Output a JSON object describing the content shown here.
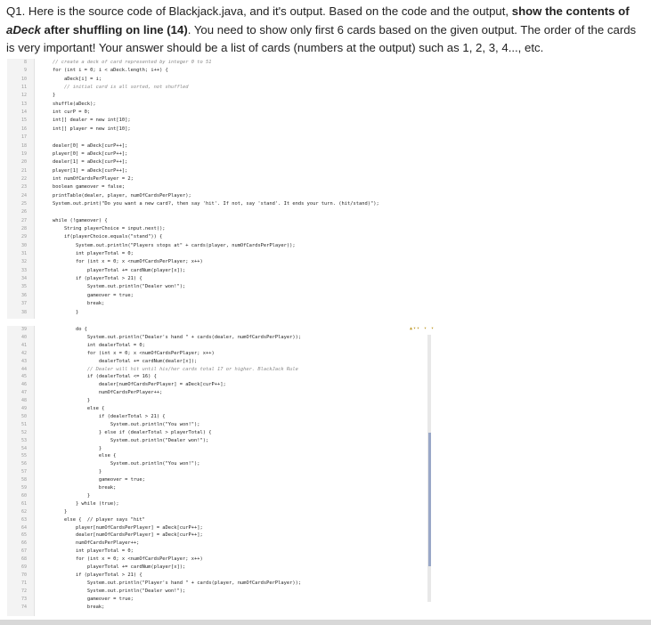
{
  "question": {
    "prefix": "Q1. Here is the source code of Blackjack.java, and it's output. Based on the code and the output, ",
    "bold_lead": "show the contents of",
    "bold_italic_term": "aDeck",
    "bold_tail": " after shuffling on line (14)",
    "rest": ". You need to show only first 6 cards based on the given output. The order of the cards is very important! Your answer should be a list of cards (numbers at the output) such as 1, 2, 3, 4..., etc."
  },
  "code_top": {
    "line_numbers": [
      "8",
      "9",
      "10",
      "11",
      "12",
      "13",
      "14",
      "15",
      "16",
      "17",
      "18",
      "19",
      "20",
      "21",
      "22",
      "23",
      "24",
      "25",
      "26",
      "27",
      "28",
      "29",
      "30",
      "31",
      "32",
      "33",
      "34",
      "35",
      "36",
      "37",
      "38"
    ],
    "lines": [
      "    // create a deck of card represented by integer 0 to 51",
      "    for (int i = 0; i < aDeck.length; i++) {",
      "        aDeck[i] = i;",
      "        // initial card is all sorted, not shuffled",
      "    }",
      "    shuffle(aDeck);",
      "    int curP = 0;",
      "    int[] dealer = new int[10];",
      "    int[] player = new int[10];",
      "",
      "    dealer[0] = aDeck[curP++];",
      "    player[0] = aDeck[curP++];",
      "    dealer[1] = aDeck[curP++];",
      "    player[1] = aDeck[curP++];",
      "    int numOfCardsPerPlayer = 2;",
      "    boolean gameover = false;",
      "    printTable(dealer, player, numOfCardsPerPlayer);",
      "    System.out.print(\"Do you want a new card?, then say 'hit'. If not, say 'stand'. It ends your turn. (hit/stand)\");",
      "",
      "    while (!gameover) {",
      "        String playerChoice = input.next();",
      "        if(playerChoice.equals(\"stand\")) {",
      "            System.out.println(\"Players stops at\" + cards(player, numOfCardsPerPlayer));",
      "            int playerTotal = 0;",
      "            for (int x = 0; x <numOfCardsPerPlayer; x++)",
      "                playerTotal += cardNum(player[x]);",
      "            if (playerTotal > 21) {",
      "                System.out.println(\"Dealer won!\");",
      "                gameover = true;",
      "                break;",
      "            }"
    ]
  },
  "code_bottom": {
    "line_numbers": [
      "39",
      "40",
      "41",
      "42",
      "43",
      "44",
      "45",
      "46",
      "47",
      "48",
      "49",
      "50",
      "51",
      "52",
      "53",
      "54",
      "55",
      "56",
      "57",
      "58",
      "59",
      "60",
      "61",
      "62",
      "63",
      "64",
      "65",
      "66",
      "67",
      "68",
      "69",
      "70",
      "71",
      "72",
      "73",
      "74"
    ],
    "lines": [
      "            do {",
      "                System.out.println(\"Dealer's hand \" + cards(dealer, numOfCardsPerPlayer));",
      "                int dealerTotal = 0;",
      "                for (int x = 0; x <numOfCardsPerPlayer; x++)",
      "                    dealerTotal += cardNum(dealer[x]);",
      "                // Dealer will hit until his/her cards total 17 or higher. BlackJack Rule",
      "                if (dealerTotal <= 16) {",
      "                    dealer[numOfCardsPerPlayer] = aDeck[curP++];",
      "                    numOfCardsPerPlayer++;",
      "                }",
      "                else {",
      "                    if (dealerTotal > 21) {",
      "                        System.out.println(\"You won!\");",
      "                    } else if (dealerTotal > playerTotal) {",
      "                        System.out.println(\"Dealer won!\");",
      "                    }",
      "                    else {",
      "                        System.out.println(\"You won!\");",
      "                    }",
      "                    gameover = true;",
      "                    break;",
      "                }",
      "            } while (true);",
      "        }",
      "        else {  // player says \"hit\"",
      "            player[numOfCardsPerPlayer] = aDeck[curP++];",
      "            dealer[numOfCardsPerPlayer] = aDeck[curP++];",
      "            numOfCardsPerPlayer++;",
      "            int playerTotal = 0;",
      "            for (int x = 0; x <numOfCardsPerPlayer; x++)",
      "                playerTotal += cardNum(player[x]);",
      "            if (playerTotal > 21) {",
      "                System.out.println(\"Player's hand \" + cards(player, numOfCardsPerPlayer));",
      "                System.out.println(\"Dealer won!\");",
      "                gameover = true;",
      "                break;"
    ],
    "scroll_marks": "▲▾▾ ▾ ▾"
  }
}
